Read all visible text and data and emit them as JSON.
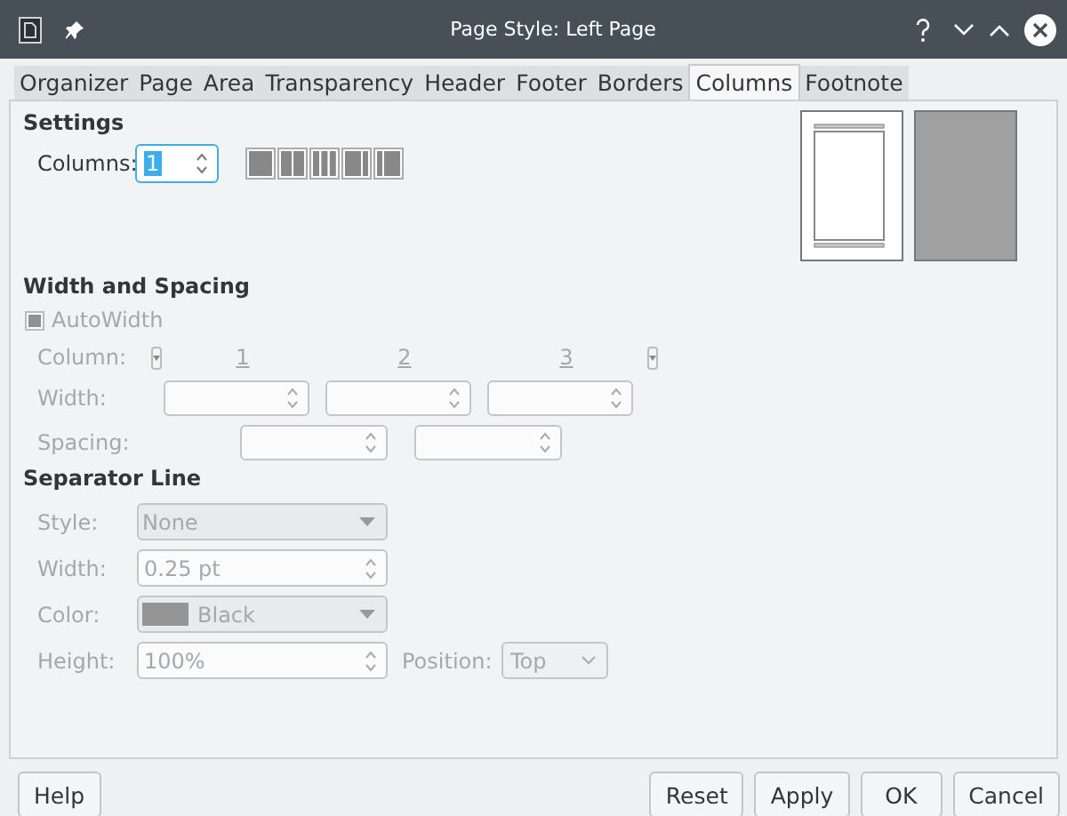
{
  "window": {
    "title": "Page Style: Left Page"
  },
  "tabs": [
    {
      "label": "Organizer",
      "selected": false
    },
    {
      "label": "Page",
      "selected": false
    },
    {
      "label": "Area",
      "selected": false
    },
    {
      "label": "Transparency",
      "selected": false
    },
    {
      "label": "Header",
      "selected": false
    },
    {
      "label": "Footer",
      "selected": false
    },
    {
      "label": "Borders",
      "selected": false
    },
    {
      "label": "Columns",
      "selected": true
    },
    {
      "label": "Footnote",
      "selected": false
    }
  ],
  "settings": {
    "heading": "Settings",
    "columns_label": "Columns:",
    "columns_value": "1"
  },
  "width_spacing": {
    "heading": "Width and Spacing",
    "disabled": true,
    "autowidth": {
      "label": "AutoWidth",
      "checked": true
    },
    "column_label": "Column:",
    "column_numbers": [
      "1",
      "2",
      "3"
    ],
    "width_label": "Width:",
    "spacing_label": "Spacing:"
  },
  "separator": {
    "heading": "Separator Line",
    "disabled": true,
    "style_label": "Style:",
    "style_value": "None",
    "width_label": "Width:",
    "width_value": "0.25 pt",
    "color_label": "Color:",
    "color_value": "Black",
    "height_label": "Height:",
    "height_value": "100%",
    "position_label": "Position:",
    "position_value": "Top"
  },
  "buttons": [
    {
      "label": "Help"
    },
    {
      "label": "Reset"
    },
    {
      "label": "Apply"
    },
    {
      "label": "OK"
    },
    {
      "label": "Cancel"
    }
  ]
}
